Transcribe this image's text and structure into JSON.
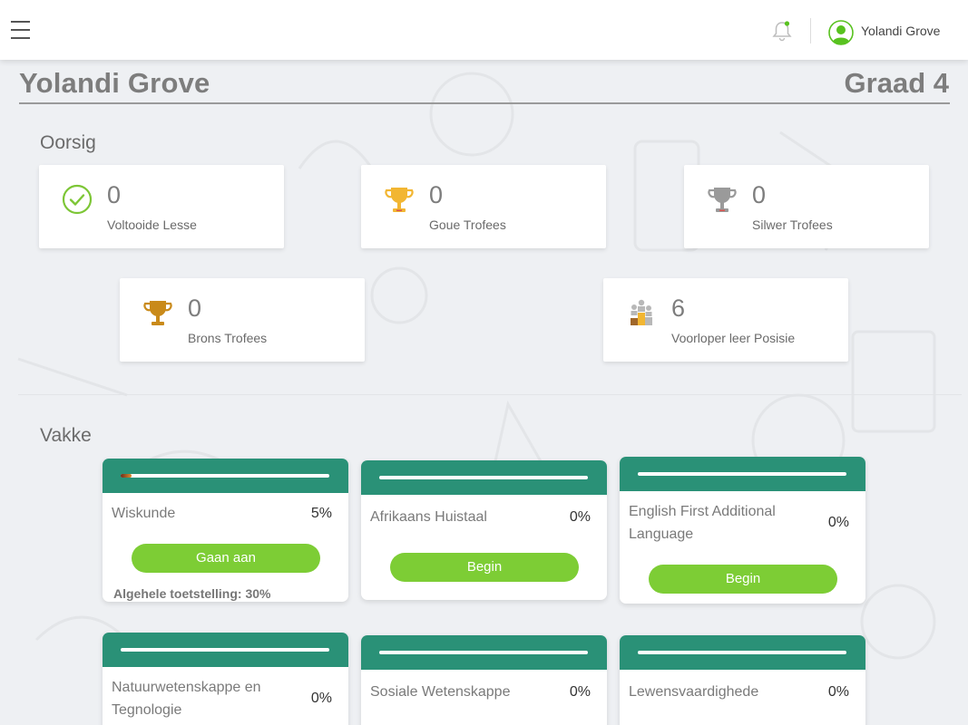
{
  "header": {
    "user_name": "Yolandi Grove",
    "menu_icon": "hamburger-icon",
    "notification_icon": "bell-icon",
    "avatar_icon": "user-avatar-icon"
  },
  "page": {
    "title": "Yolandi Grove",
    "grade": "Graad 4"
  },
  "overview": {
    "label": "Oorsig",
    "stats": [
      {
        "value": "0",
        "label": "Voltooide Lesse",
        "icon": "check-circle-icon"
      },
      {
        "value": "0",
        "label": "Goue Trofees",
        "icon": "gold-trophy-icon"
      },
      {
        "value": "0",
        "label": "Silwer Trofees",
        "icon": "silver-trophy-icon"
      },
      {
        "value": "0",
        "label": "Brons Trofees",
        "icon": "bronze-trophy-icon"
      },
      {
        "value": "6",
        "label": "Voorloper leer Posisie",
        "icon": "leaderboard-podium-icon"
      }
    ]
  },
  "subjects": {
    "label": "Vakke",
    "items": [
      {
        "name": "Wiskunde",
        "percent": "5%",
        "progress": 0.05,
        "button": "Gaan aan",
        "note": "Algehele toetstelling: 30%"
      },
      {
        "name": "Afrikaans Huistaal",
        "percent": "0%",
        "progress": 0,
        "button": "Begin"
      },
      {
        "name": "English First Additional Language",
        "percent": "0%",
        "progress": 0,
        "button": "Begin"
      },
      {
        "name": "Natuurwetenskappe en Tegnologie",
        "percent": "0%",
        "progress": 0
      },
      {
        "name": "Sosiale Wetenskappe",
        "percent": "0%",
        "progress": 0
      },
      {
        "name": "Lewensvaardighede",
        "percent": "0%",
        "progress": 0
      }
    ]
  },
  "colors": {
    "accent_green": "#2a9177",
    "button_green": "#7dcd35",
    "gold": "#f2b632",
    "silver": "#9a9a9a",
    "bronze": "#c98a1a"
  }
}
